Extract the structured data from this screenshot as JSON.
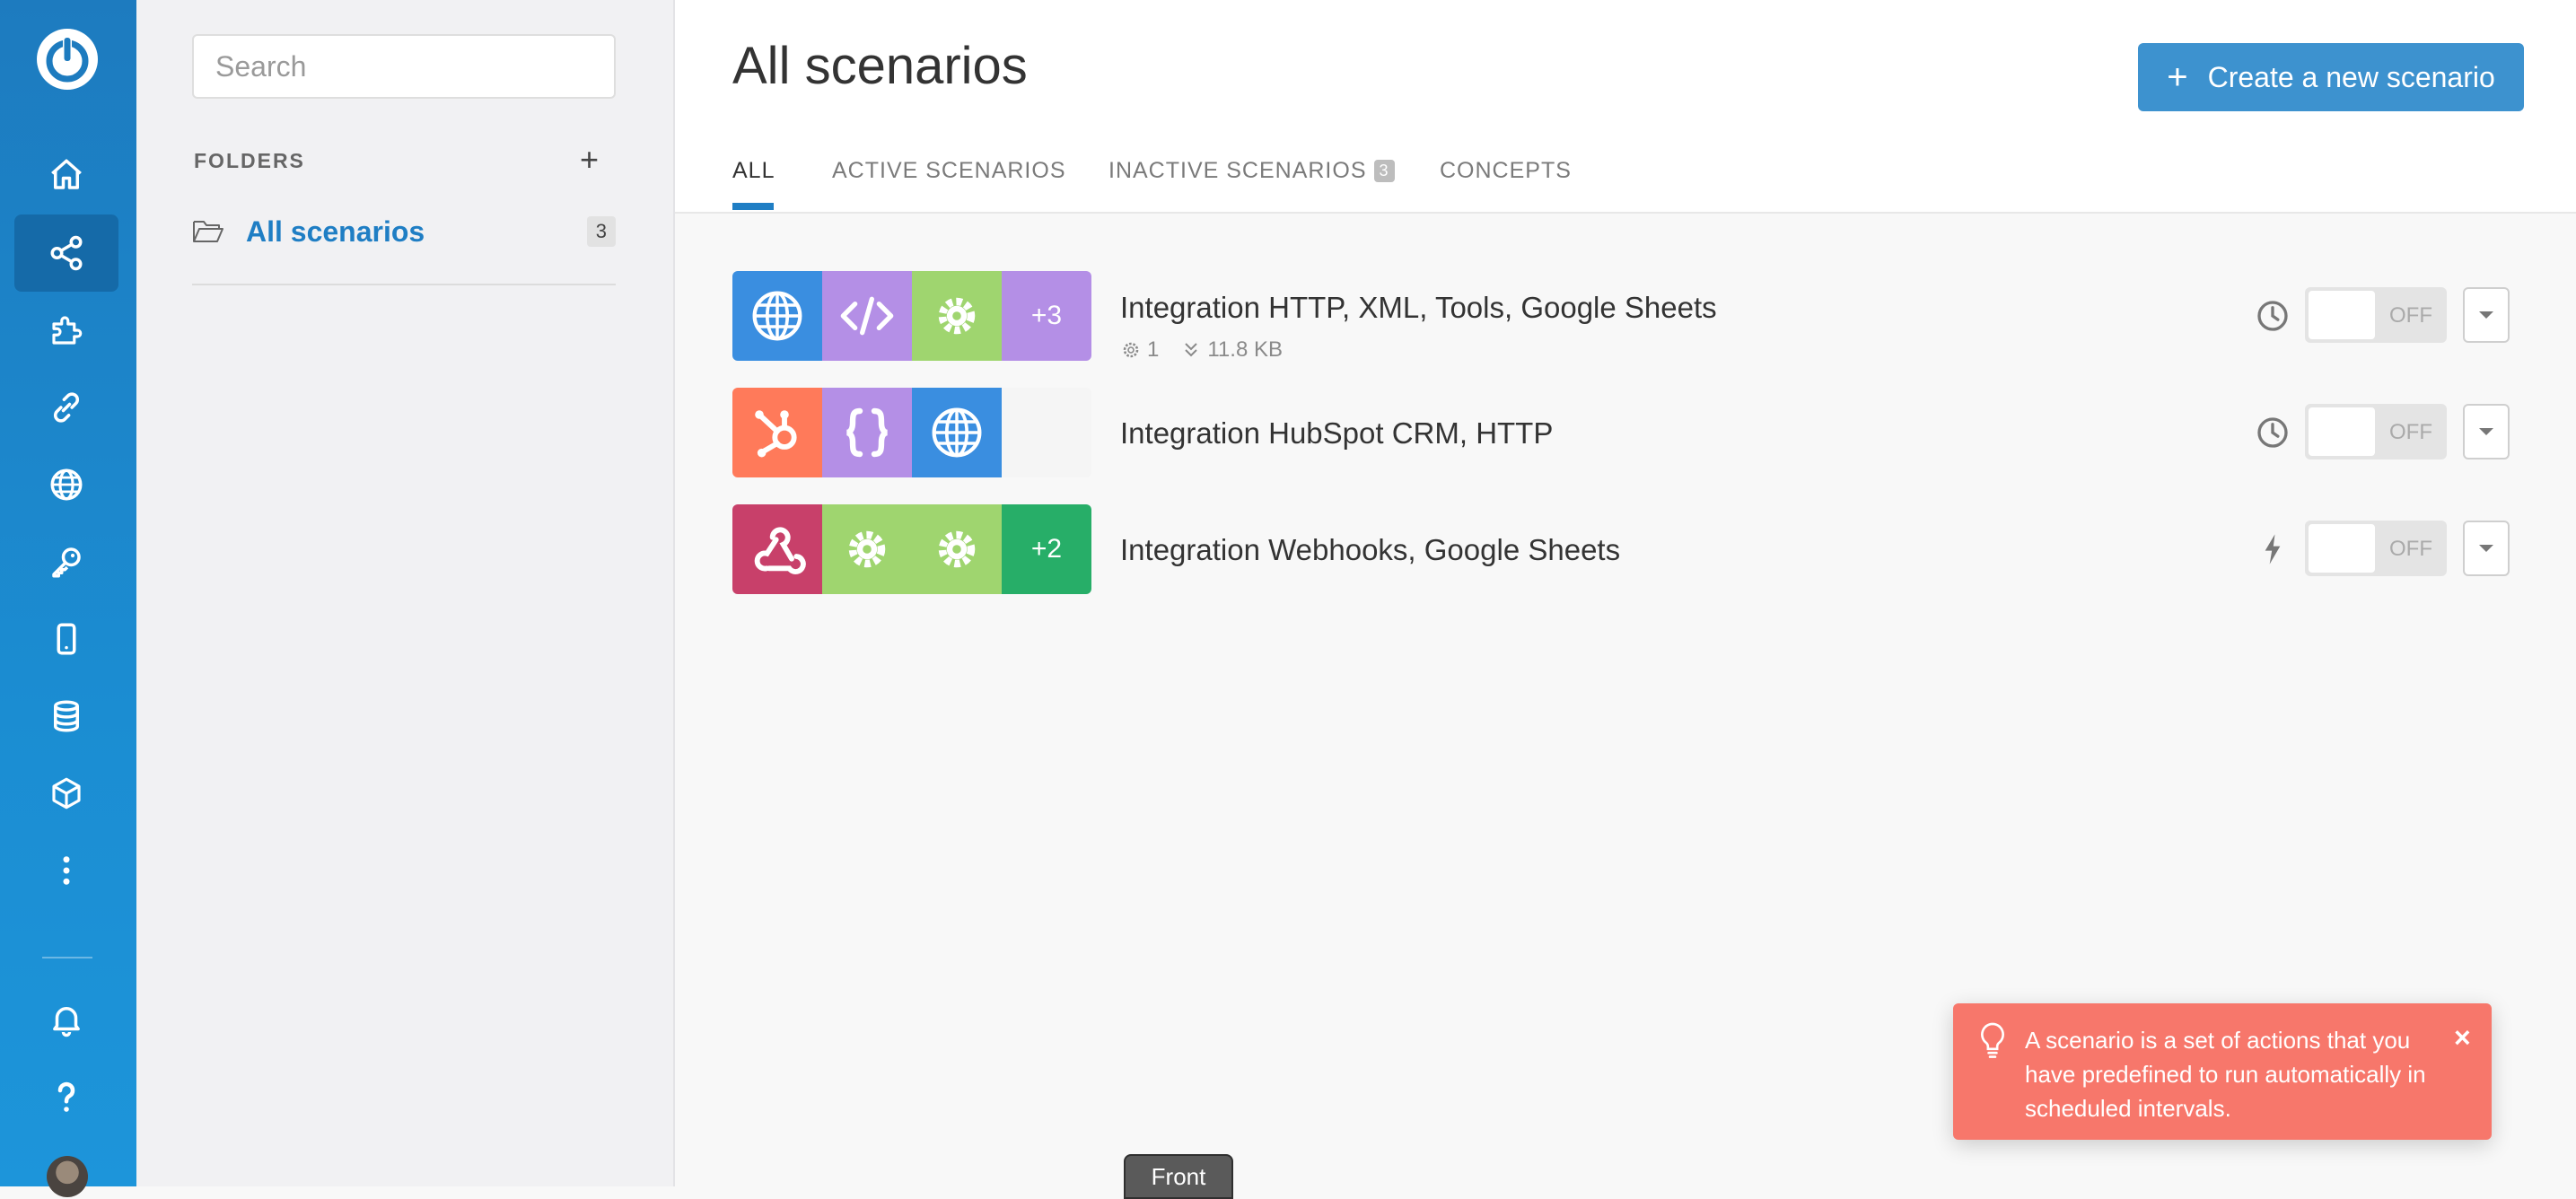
{
  "colors": {
    "rail": "#1b8dd2",
    "accent": "#1f7ec4",
    "create_button": "#3d92cf",
    "toast": "#f7776b",
    "tile_blue": "#3a8ee0",
    "tile_purple": "#b48fe6",
    "tile_green": "#9fd56f",
    "tile_orange": "#ff7a5a",
    "tile_crimson": "#c8406a",
    "tile_teal_green": "#27ae68"
  },
  "sidebar": {
    "items": [
      {
        "icon": "home-icon"
      },
      {
        "icon": "share-icon",
        "active": true
      },
      {
        "icon": "puzzle-icon"
      },
      {
        "icon": "link-icon"
      },
      {
        "icon": "globe-icon"
      },
      {
        "icon": "key-icon"
      },
      {
        "icon": "mobile-icon"
      },
      {
        "icon": "database-icon"
      },
      {
        "icon": "cube-icon"
      },
      {
        "icon": "more-vertical-icon"
      }
    ],
    "bottom": [
      {
        "icon": "bell-icon"
      },
      {
        "icon": "help-icon"
      },
      {
        "icon": "avatar"
      }
    ]
  },
  "search": {
    "placeholder": "Search",
    "value": ""
  },
  "folders": {
    "label": "FOLDERS",
    "add_label": "+",
    "items": [
      {
        "name": "All scenarios",
        "count": "3"
      }
    ]
  },
  "header": {
    "title": "All scenarios",
    "create_label": "Create a new scenario",
    "create_icon": "+"
  },
  "tabs": [
    {
      "label": "ALL",
      "active": true
    },
    {
      "label": "ACTIVE SCENARIOS"
    },
    {
      "label": "INACTIVE SCENARIOS",
      "badge": "3"
    },
    {
      "label": "CONCEPTS"
    }
  ],
  "scenarios": [
    {
      "name": "Integration HTTP, XML, Tools, Google Sheets",
      "tiles": [
        {
          "icon": "globe-icon",
          "color": "#3a8ee0"
        },
        {
          "icon": "code-icon",
          "color": "#b48fe6"
        },
        {
          "icon": "gear-icon",
          "color": "#9fd56f"
        },
        {
          "text": "+3",
          "color": "#b48fe6"
        }
      ],
      "ops": "1",
      "data_size": "11.8 KB",
      "schedule_icon": "clock-icon",
      "toggle_label": "OFF"
    },
    {
      "name": "Integration HubSpot CRM, HTTP",
      "tiles": [
        {
          "icon": "hubspot-icon",
          "color": "#ff7a5a"
        },
        {
          "icon": "braces-icon",
          "color": "#b48fe6"
        },
        {
          "icon": "globe-icon",
          "color": "#3a8ee0"
        }
      ],
      "schedule_icon": "clock-icon",
      "toggle_label": "OFF"
    },
    {
      "name": "Integration Webhooks, Google Sheets",
      "tiles": [
        {
          "icon": "webhook-icon",
          "color": "#c8406a"
        },
        {
          "icon": "gear-icon",
          "color": "#9fd56f"
        },
        {
          "icon": "gear-icon",
          "color": "#9fd56f"
        },
        {
          "text": "+2",
          "color": "#27ae68"
        }
      ],
      "schedule_icon": "lightning-icon",
      "toggle_label": "OFF"
    }
  ],
  "toast": {
    "text": "A scenario is a set of actions that you have predefined to run automatically in scheduled intervals.",
    "icon": "lightbulb-icon",
    "close_label": "×"
  },
  "bottom_tab": {
    "label": "Front"
  }
}
